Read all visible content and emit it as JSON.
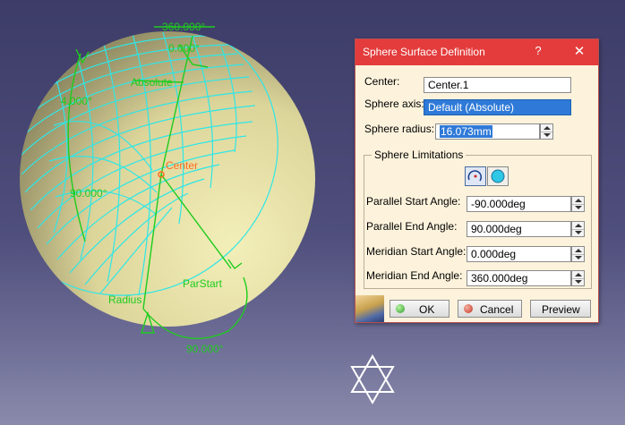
{
  "viewport": {
    "labels": {
      "angle_360": "360.000°",
      "angle_0": "0.000°",
      "absolute": "Absolute",
      "center": "Center",
      "radius": "Radius",
      "parstart": "ParStart",
      "angle_90": "90.000°",
      "left_arc": "90.000°",
      "left_small": "4.000°"
    },
    "colors": {
      "wireframe": "#2ee6e6",
      "annotation": "#1ecc1e",
      "center_label": "#ff6a1e",
      "sphere_fill": "#e6e0a0"
    }
  },
  "dialog": {
    "title": "Sphere Surface Definition",
    "help_icon": "?",
    "close_icon": "✕",
    "center_label": "Center:",
    "center_value": "Center.1",
    "axis_label": "Sphere axis:",
    "axis_value": "Default (Absolute)",
    "radius_label": "Sphere radius:",
    "radius_value": "16.073mm",
    "limits": {
      "legend": "Sphere Limitations",
      "parallel_start_label": "Parallel Start Angle:",
      "parallel_start_value": "-90.000deg",
      "parallel_end_label": "Parallel End Angle:",
      "parallel_end_value": "90.000deg",
      "meridian_start_label": "Meridian Start Angle:",
      "meridian_start_value": "0.000deg",
      "meridian_end_label": "Meridian End Angle:",
      "meridian_end_value": "360.000deg"
    },
    "buttons": {
      "ok": "OK",
      "cancel": "Cancel",
      "preview": "Preview"
    }
  }
}
